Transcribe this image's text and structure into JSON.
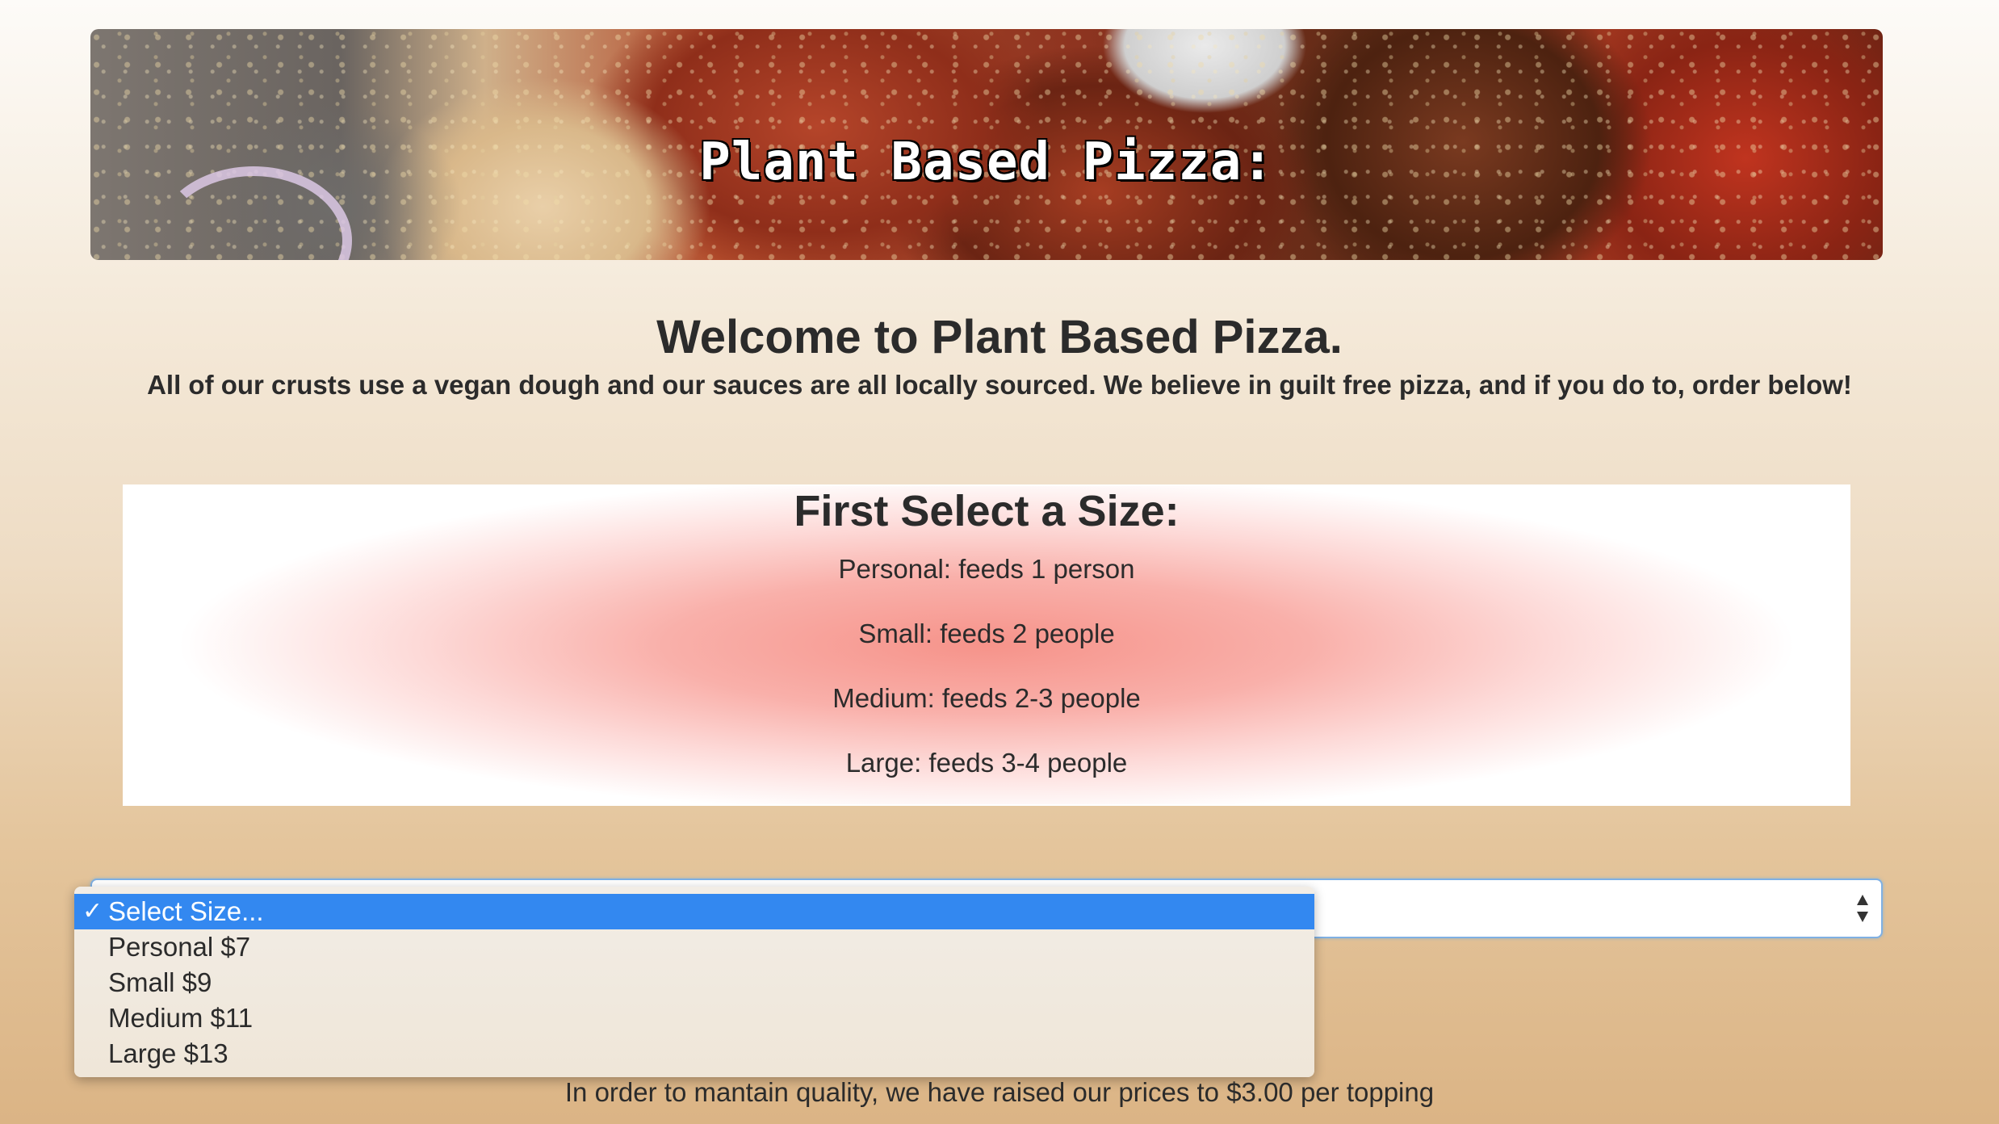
{
  "banner": {
    "title": "Plant Based Pizza:"
  },
  "welcome": {
    "heading": "Welcome to Plant Based Pizza.",
    "text": "All of our crusts use a vegan dough and our sauces are all locally sourced. We believe in guilt free pizza, and if you do to, order below!"
  },
  "size_panel": {
    "heading": "First Select a Size:",
    "lines": [
      "Personal: feeds 1 person",
      "Small: feeds 2 people",
      "Medium: feeds 2-3 people",
      "Large: feeds 3-4 people"
    ]
  },
  "size_select": {
    "selected": "Select Size...",
    "check_glyph": "✓",
    "arrows_glyph": "▲▼",
    "options": [
      "Select Size...",
      "Personal $7",
      "Small $9",
      "Medium $11",
      "Large $13"
    ]
  },
  "price_note": "In order to mantain quality, we have raised our prices to $3.00 per topping",
  "colors": {
    "selected_option_bg": "#3388f0",
    "panel_center": "#f6938a",
    "select_focus_border": "#7fb0e3"
  }
}
